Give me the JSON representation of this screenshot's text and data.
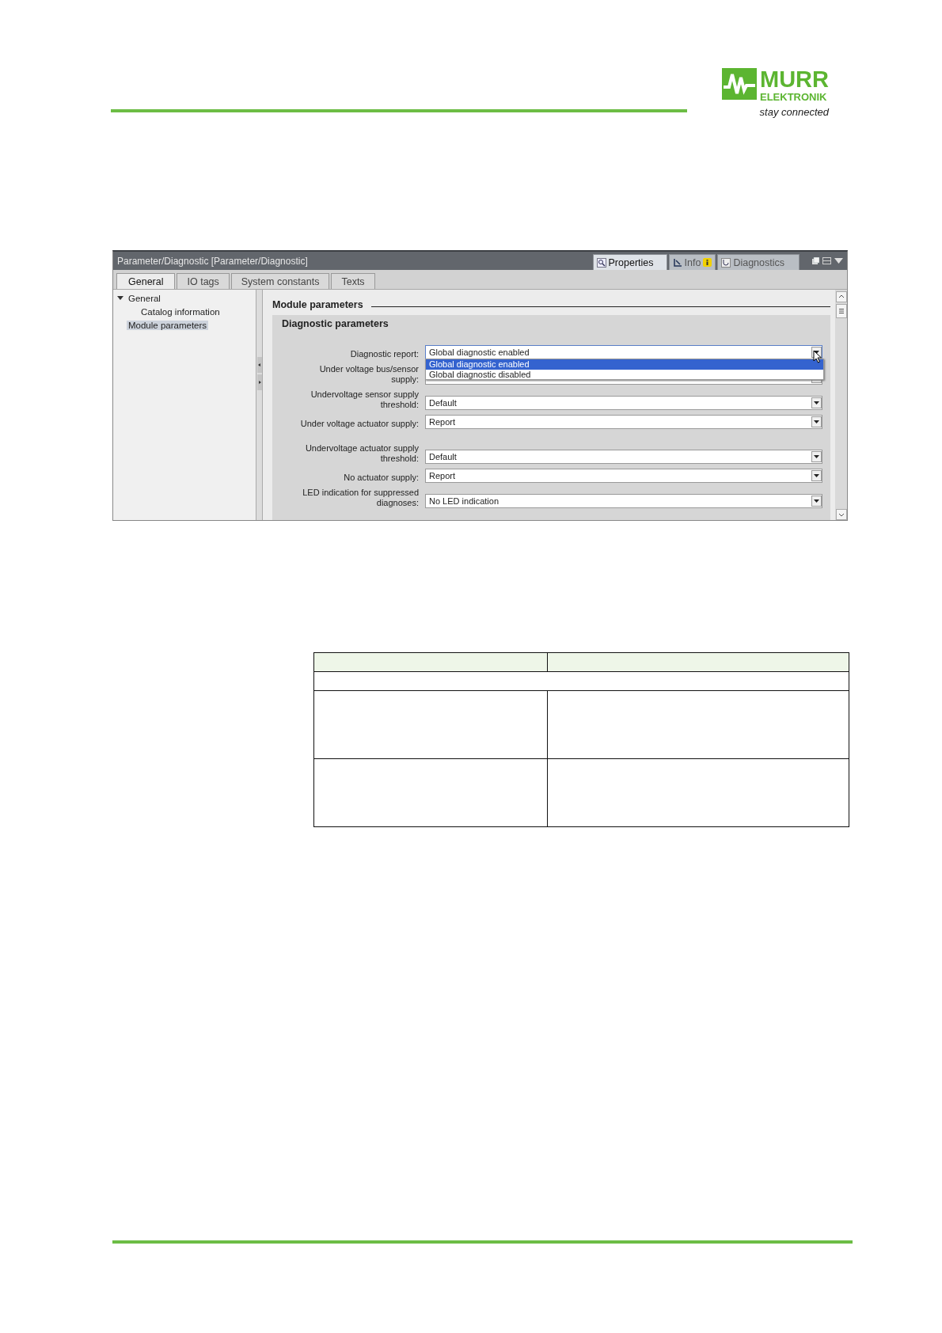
{
  "logo": {
    "name_top": "MURR",
    "name_bottom": "ELEKTRONIK",
    "tagline": "stay connected"
  },
  "window": {
    "title": "Parameter/Diagnostic [Parameter/Diagnostic]",
    "panel_tabs": [
      {
        "label": "Properties",
        "kind": "properties",
        "selected": true
      },
      {
        "label": "Info",
        "kind": "info",
        "selected": false
      },
      {
        "label": "Diagnostics",
        "kind": "diagnostics",
        "selected": false
      }
    ],
    "tabs": [
      {
        "label": "General",
        "selected": true
      },
      {
        "label": "IO tags",
        "selected": false
      },
      {
        "label": "System constants",
        "selected": false
      },
      {
        "label": "Texts",
        "selected": false
      }
    ],
    "tree": [
      {
        "label": "General",
        "selected": false,
        "expanded": true,
        "children": [
          {
            "label": "Catalog information",
            "selected": false
          }
        ]
      },
      {
        "label": "Module parameters",
        "selected": true
      }
    ],
    "section_title": "Module parameters",
    "group_title": "Diagnostic parameters",
    "parameters": [
      {
        "label_lines": [
          "Diagnostic report:"
        ],
        "value": "Global diagnostic enabled",
        "open": true,
        "options": [
          {
            "label": "Global diagnostic enabled",
            "selected": true
          },
          {
            "label": "Global diagnostic disabled",
            "selected": false
          }
        ]
      },
      {
        "label_lines": [
          "Under voltage bus/sensor",
          "supply:"
        ],
        "open": false
      },
      {
        "label_lines": [
          "Undervoltage sensor supply",
          "threshold:"
        ],
        "value": "Default",
        "open": false
      },
      {
        "label_lines": [
          "Under voltage actuator supply:"
        ],
        "value": "Report",
        "open": false
      },
      {
        "label_lines": [
          "Undervoltage actuator supply",
          "threshold:"
        ],
        "value": "Default",
        "open": false
      },
      {
        "label_lines": [
          "No actuator supply:"
        ],
        "value": "Report",
        "open": false
      },
      {
        "label_lines": [
          "LED indication for suppressed",
          "diagnoses:"
        ],
        "value": "No LED indication",
        "open": false
      }
    ]
  }
}
